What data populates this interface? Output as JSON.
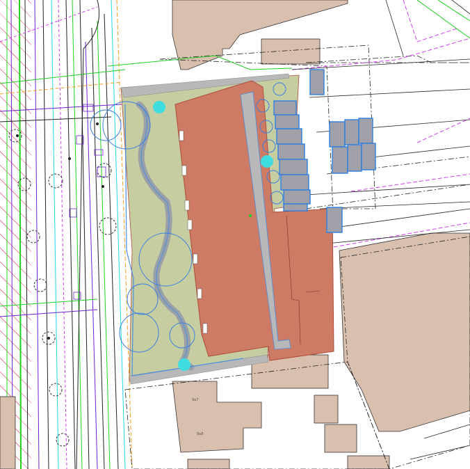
{
  "map": {
    "colors": {
      "background": "#ffffff",
      "existing_building": "#d9bfae",
      "new_building": "#cd7b64",
      "new_building_outline": "#b04a3a",
      "green_space": "#c6cda0",
      "paving": "#b8b8b8",
      "path": "#9aa0a8",
      "parking": "#a0a0a8",
      "parking_outline": "#2f7fe0",
      "tree": "#3a7fe0",
      "tree_marker": "#40dde0",
      "road_hatch": "#e0203a",
      "line_black": "#222222",
      "line_green": "#20d020",
      "line_magenta": "#d040f0",
      "line_purple": "#7020d0",
      "line_cyan": "#20d8e8",
      "line_orange": "#f0a020"
    },
    "labels": {
      "lot_a": "9a7",
      "lot_b": "9a8"
    }
  }
}
